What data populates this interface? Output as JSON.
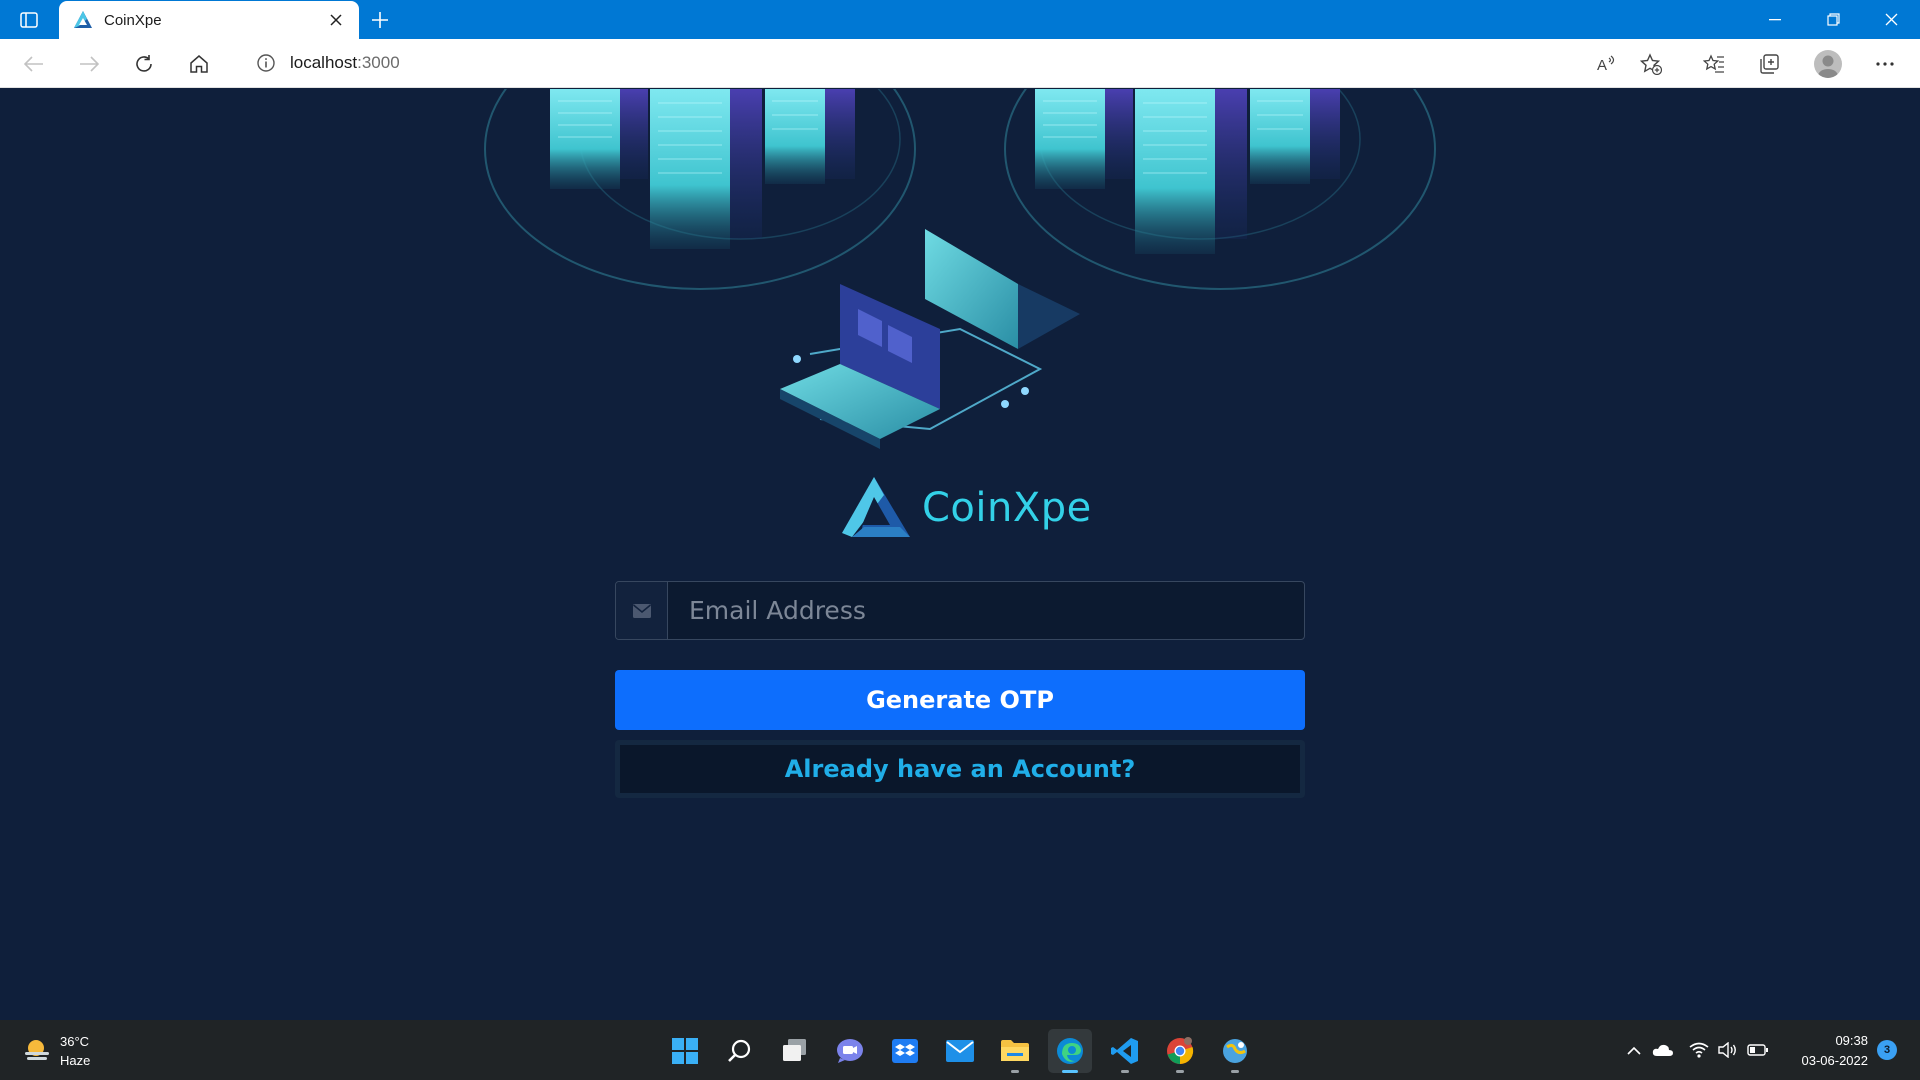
{
  "browser": {
    "tab_title": "CoinXpe",
    "url_host": "localhost",
    "url_port": ":3000"
  },
  "page": {
    "brand_name": "CoinXpe",
    "email_placeholder": "Email Address",
    "generate_otp_label": "Generate OTP",
    "existing_account_label": "Already have an Account?",
    "colors": {
      "background": "#0f1f3b",
      "brand": "#33d1e8",
      "primary_button": "#0d6efd",
      "link_text": "#20aee8"
    }
  },
  "taskbar": {
    "weather_temp": "36°C",
    "weather_condition": "Haze",
    "time": "09:38",
    "date": "03-06-2022",
    "notification_count": "3",
    "apps": [
      "start",
      "search",
      "task-view",
      "teams-chat",
      "dropbox",
      "mail",
      "file-explorer",
      "edge",
      "vscode",
      "chrome",
      "app"
    ]
  }
}
